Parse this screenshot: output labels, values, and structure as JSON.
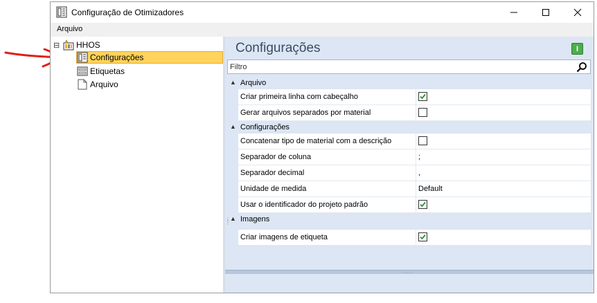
{
  "window": {
    "title": "Configuração de Otimizadores",
    "app_icon": "settings-document-icon",
    "controls": [
      "minimize-icon",
      "maximize-icon",
      "close-icon"
    ]
  },
  "menu": {
    "items": [
      "Arquivo"
    ]
  },
  "tree": {
    "root": {
      "label": "HHOS",
      "expander": "⊟",
      "icon": "project-icon"
    },
    "children": [
      {
        "label": "Configurações",
        "icon": "settings-document-icon",
        "selected": true
      },
      {
        "label": "Etiquetas",
        "icon": "label-icon",
        "selected": false
      },
      {
        "label": "Arquivo",
        "icon": "file-icon",
        "selected": false
      }
    ]
  },
  "panel": {
    "title": "Configurações",
    "action_button": "I",
    "filter_placeholder": "Filtro"
  },
  "properties": {
    "categories": [
      {
        "label": "Arquivo",
        "items": [
          {
            "name": "Criar primeira linha com cabeçalho",
            "type": "checkbox",
            "checked": true
          },
          {
            "name": "Gerar arquivos separados por material",
            "type": "checkbox",
            "checked": false
          }
        ]
      },
      {
        "label": "Configurações",
        "items": [
          {
            "name": "Concatenar tipo de material com a descrição",
            "type": "checkbox",
            "checked": false
          },
          {
            "name": "Separador de coluna",
            "type": "text",
            "value": ";"
          },
          {
            "name": "Separador decimal",
            "type": "text",
            "value": ","
          },
          {
            "name": "Unidade de medida",
            "type": "text",
            "value": "Default"
          },
          {
            "name": "Usar o identificador do projeto padrão",
            "type": "checkbox",
            "checked": true
          }
        ]
      },
      {
        "label": "Imagens",
        "items": [
          {
            "name": "Criar imagens de etiqueta",
            "type": "checkbox",
            "checked": true
          }
        ]
      }
    ]
  },
  "colors": {
    "annotation_arrow": "#e0201b",
    "selection": "#ffd35c",
    "check": "#2f8f2f"
  }
}
